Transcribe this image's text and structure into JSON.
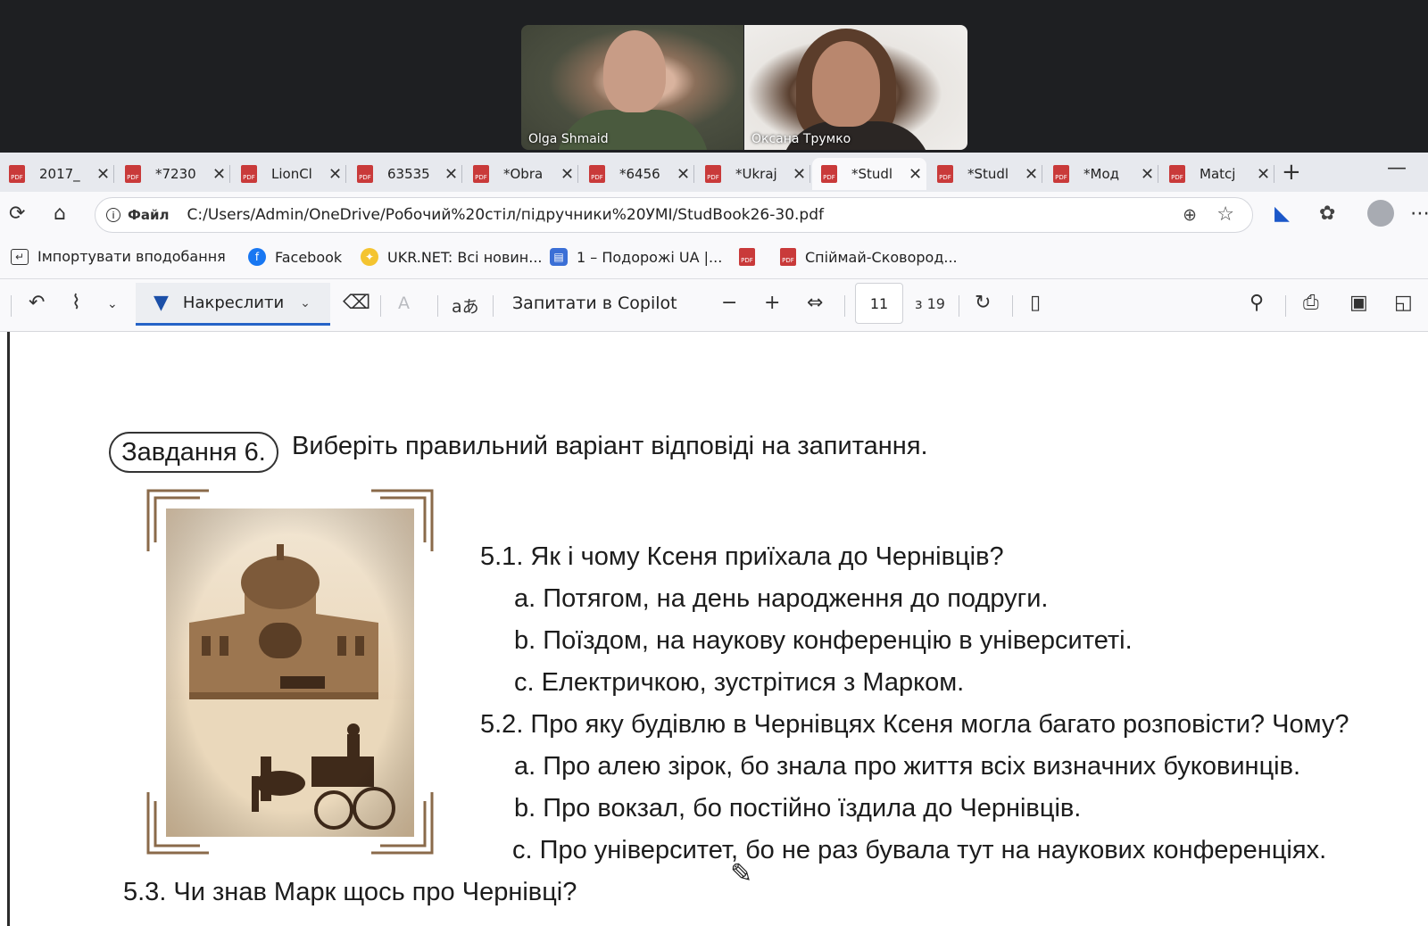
{
  "call": {
    "participants": [
      {
        "name": "Olga Shmaid"
      },
      {
        "name": "Оксана Трумко"
      }
    ]
  },
  "tabs": [
    {
      "title": "2017_",
      "active": false
    },
    {
      "title": "*7230",
      "active": false
    },
    {
      "title": "LionCl",
      "active": false
    },
    {
      "title": "63535",
      "active": false
    },
    {
      "title": "*Obra",
      "active": false
    },
    {
      "title": "*6456",
      "active": false
    },
    {
      "title": "*Ukraj",
      "active": false
    },
    {
      "title": "*Studl",
      "active": true
    },
    {
      "title": "*Studl",
      "active": false
    },
    {
      "title": "*Мод",
      "active": false
    },
    {
      "title": "Matcj",
      "active": false
    }
  ],
  "address_bar": {
    "file_label": "Файл",
    "url": "C:/Users/Admin/OneDrive/Робочий%20стіл/підручники%20УМІ/StudBook26-30.pdf"
  },
  "favorites": [
    {
      "label": "Імпортувати вподобання",
      "icon": "import-icon"
    },
    {
      "label": "Facebook",
      "icon": "facebook-icon"
    },
    {
      "label": "UKR.NET: Всі новин...",
      "icon": "ukrnet-icon"
    },
    {
      "label": "1 – Подорожі UA |...",
      "icon": "bus-icon"
    },
    {
      "label": "",
      "icon": "pdf-icon"
    },
    {
      "label": "Спіймай-Сковород...",
      "icon": "pdf-icon"
    }
  ],
  "pdf_toolbar": {
    "draw_label": "Накреслити",
    "copilot_label": "Запитати в Copilot",
    "current_page": "11",
    "total_pages": "з 19",
    "read_aloud_glyph": "aあ"
  },
  "document": {
    "task_label": "Завдання 6.",
    "task_text": "Виберіть правильний варіант відповіді на запитання.",
    "questions": [
      {
        "text": "5.1. Як і чому Ксеня приїхала до Чернівців?",
        "options": [
          "a. Потягом, на день народження до подруги.",
          "b. Поїздом, на наукову конференцію в університеті.",
          "c. Електричкою, зустрітися з Марком."
        ]
      },
      {
        "text": "5.2. Про яку будівлю в Чернівцях Ксеня могла багато розповісти? Чому?",
        "options": [
          "a. Про алею зірок, бо знала про життя всіх визначних буковинців.",
          "b. Про вокзал, бо постійно їздила до Чернівців.",
          "c. Про університет, бо не раз бувала тут на наукових конференціях."
        ]
      },
      {
        "text": "5.3. Чи знав Марк щось про Чернівці?",
        "options": []
      }
    ]
  },
  "colors": {
    "accent": "#2563c7",
    "pdf_red": "#c93a3a",
    "sepia": "#b9956a"
  }
}
